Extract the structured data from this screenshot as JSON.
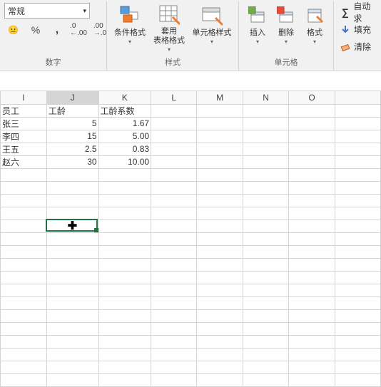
{
  "ribbon": {
    "number": {
      "format_select": "常规",
      "group_label": "数字"
    },
    "styles": {
      "cond_format": "条件格式",
      "table_format": "套用\n表格格式",
      "cell_styles": "单元格样式",
      "group_label": "样式"
    },
    "cells": {
      "insert": "插入",
      "delete": "删除",
      "format": "格式",
      "group_label": "单元格"
    },
    "editing": {
      "autosum": "自动求",
      "fill": "填充",
      "clear": "清除"
    }
  },
  "columns": [
    "I",
    "J",
    "K",
    "L",
    "M",
    "N",
    "O"
  ],
  "selected_column": "J",
  "chart_data": {
    "type": "table",
    "headers": {
      "I": "员工",
      "J": "工龄",
      "K": "工龄系数"
    },
    "rows": [
      {
        "I": "张三",
        "J": "5",
        "K": "1.67"
      },
      {
        "I": "李四",
        "J": "15",
        "K": "5.00"
      },
      {
        "I": "王五",
        "J": "2.5",
        "K": "0.83"
      },
      {
        "I": "赵六",
        "J": "30",
        "K": "10.00"
      }
    ]
  },
  "cursor_glyph": "✚"
}
